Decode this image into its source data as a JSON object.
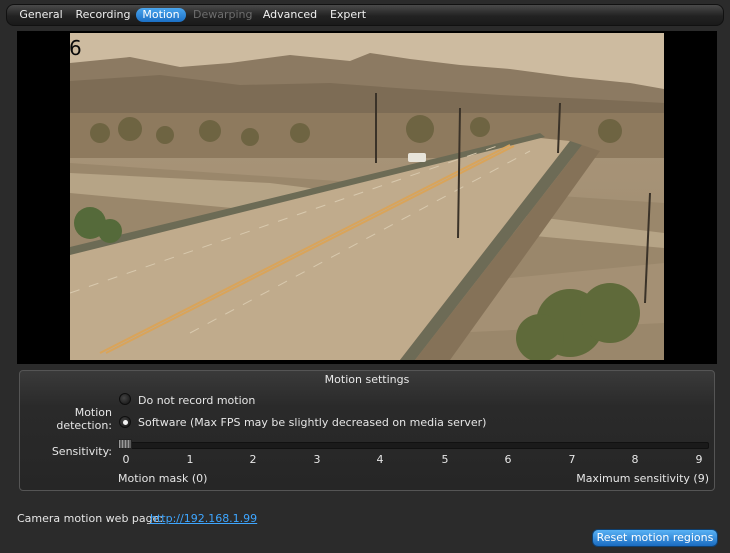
{
  "tabs": [
    {
      "label": "General",
      "state": "normal"
    },
    {
      "label": "Recording",
      "state": "normal"
    },
    {
      "label": "Motion",
      "state": "active"
    },
    {
      "label": "Dewarping",
      "state": "disabled"
    },
    {
      "label": "Advanced",
      "state": "normal"
    },
    {
      "label": "Expert",
      "state": "normal"
    }
  ],
  "video": {
    "camera_number": "6"
  },
  "motion_settings": {
    "title": "Motion settings",
    "detection_label": "Motion detection:",
    "options": [
      {
        "label": "Do not record motion",
        "checked": false
      },
      {
        "label": "Software (Max FPS may be slightly decreased on media server)",
        "checked": true
      }
    ],
    "sensitivity_label": "Sensitivity:",
    "ticks": [
      "0",
      "1",
      "2",
      "3",
      "4",
      "5",
      "6",
      "7",
      "8",
      "9"
    ],
    "sensitivity_value": 0,
    "motion_mask_label": "Motion mask (0)",
    "max_sensitivity_label": "Maximum sensitivity (9)"
  },
  "footer": {
    "web_page_label": "Camera motion web page:",
    "web_page_link": "http://192.168.1.99",
    "reset_button": "Reset motion regions"
  },
  "colors": {
    "accent": "#2b86d8",
    "background": "#2b2b2b",
    "link": "#3ea6ff"
  }
}
